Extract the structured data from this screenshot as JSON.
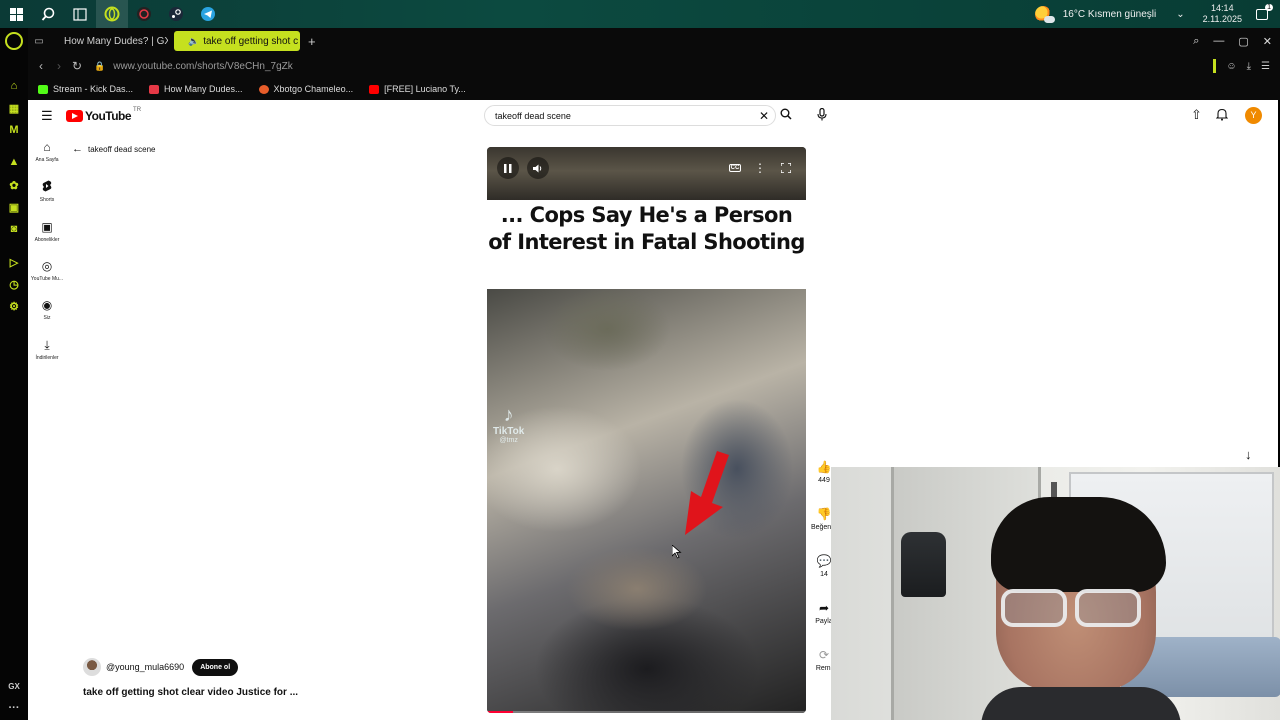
{
  "taskbar": {
    "weather": "16°C  Kısmen güneşli",
    "time": "14:14",
    "date": "2.11.2025",
    "notification_count": "1"
  },
  "tabs": [
    {
      "label": "How Many Dudes? | GX",
      "favicon_color": "#e63946"
    },
    {
      "label": "take off getting shot c",
      "favicon_color": "#ff0000",
      "active": true
    }
  ],
  "address": {
    "url": "www.youtube.com/shorts/V8eCHn_7gZk"
  },
  "bookmarks": [
    {
      "label": "Stream - Kick Das...",
      "color": "#53fc18"
    },
    {
      "label": "How Many Dudes...",
      "color": "#e63946"
    },
    {
      "label": "Xbotgo Chameleo...",
      "color": "#e85d2a"
    },
    {
      "label": "[FREE] Luciano Ty...",
      "color": "#ff0000"
    }
  ],
  "youtube": {
    "logo_text": "YouTube",
    "region": "TR",
    "search_value": "takeoff dead scene",
    "avatar_letter": "Y",
    "sidebar": [
      {
        "label": "Ana Sayfa",
        "icon": "home-icon"
      },
      {
        "label": "Shorts",
        "icon": "shorts-icon"
      },
      {
        "label": "Abonelikler",
        "icon": "subscriptions-icon"
      },
      {
        "label": "YouTube Mu...",
        "icon": "youtube-music-icon"
      },
      {
        "label": "Siz",
        "icon": "you-icon"
      },
      {
        "label": "İndirilenler",
        "icon": "downloads-icon"
      }
    ],
    "back_label": "takeoff dead scene"
  },
  "short": {
    "headline": "... Cops Say He's a Person of Interest in Fatal Shooting",
    "watermark": "TikTok",
    "watermark_handle": "@tmz",
    "progress": 0.08,
    "channel": "@young_mula6690",
    "subscribe_label": "Abone ol",
    "title": "take off getting shot clear video Justice for ...",
    "actions": [
      {
        "label": "449",
        "icon": "like-icon"
      },
      {
        "label": "Beğenm",
        "icon": "dislike-icon"
      },
      {
        "label": "14",
        "icon": "comment-icon"
      },
      {
        "label": "Payla",
        "icon": "share-icon"
      },
      {
        "label": "Remi",
        "icon": "remix-icon"
      }
    ]
  },
  "colors": {
    "gx_accent": "#c5e01f",
    "yt_red": "#ff0000"
  }
}
